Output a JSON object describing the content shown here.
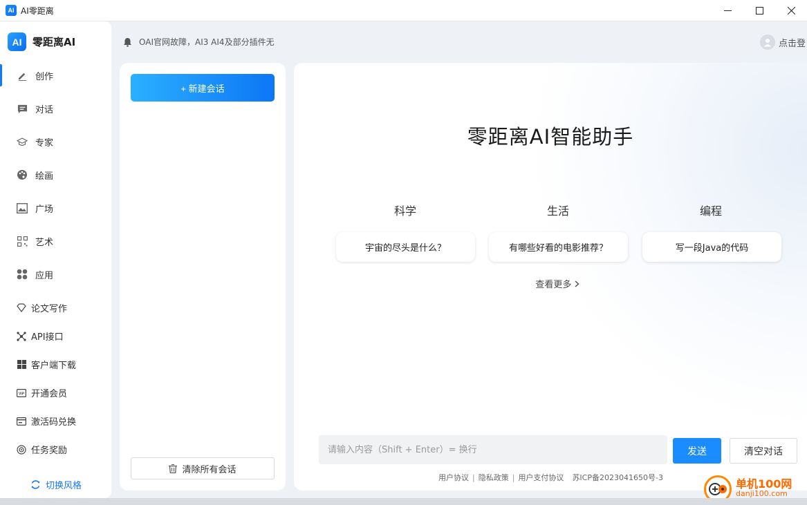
{
  "window": {
    "icon_text": "AI",
    "title": "AI零距离"
  },
  "brand": {
    "logo_text": "AI",
    "name": "零距离AI"
  },
  "nav_main": [
    {
      "label": "创作",
      "icon": "pencil-icon"
    },
    {
      "label": "对话",
      "icon": "chat-icon"
    },
    {
      "label": "专家",
      "icon": "graduation-cap-icon"
    },
    {
      "label": "绘画",
      "icon": "palette-icon"
    },
    {
      "label": "广场",
      "icon": "image-icon"
    },
    {
      "label": "艺术",
      "icon": "qr-code-icon"
    },
    {
      "label": "应用",
      "icon": "apps-icon"
    }
  ],
  "nav_sub": [
    {
      "label": "论文写作",
      "icon": "diamond-icon"
    },
    {
      "label": "API接口",
      "icon": "api-icon"
    },
    {
      "label": "客户端下载",
      "icon": "windows-icon"
    },
    {
      "label": "开通会员",
      "icon": "vip-icon"
    },
    {
      "label": "激活码兑换",
      "icon": "card-icon"
    },
    {
      "label": "任务奖励",
      "icon": "reward-icon"
    }
  ],
  "switch_style": "切换风格",
  "notice": "OAI官网故障，AI3 AI4及部分插件无",
  "login": "点击登",
  "session_panel": {
    "new_chat": "+ 新建会话",
    "clear_all": "清除所有会话"
  },
  "main": {
    "title": "零距离AI智能助手",
    "categories": [
      {
        "name": "科学",
        "prompt": "宇宙的尽头是什么？"
      },
      {
        "name": "生活",
        "prompt": "有哪些好看的电影推荐？"
      },
      {
        "name": "编程",
        "prompt": "写一段Java的代码"
      }
    ],
    "see_more": "查看更多",
    "input_placeholder": "请输入内容（Shift + Enter）= 换行",
    "send": "发送",
    "clear_chat": "清空对话",
    "footer": {
      "user_agreement": "用户协议",
      "privacy": "隐私政策",
      "payment": "用户支付协议",
      "icp": "苏ICP备2023041650号-3"
    }
  },
  "watermark": {
    "cn": "单机100网",
    "en": "danji100.com"
  }
}
